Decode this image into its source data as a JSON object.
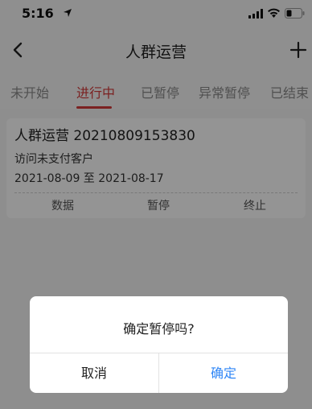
{
  "status_bar": {
    "time": "5:16"
  },
  "nav": {
    "title": "人群运营"
  },
  "tabs": [
    {
      "label": "未开始"
    },
    {
      "label": "进行中",
      "active": true
    },
    {
      "label": "已暂停"
    },
    {
      "label": "异常暂停"
    },
    {
      "label": "已结束"
    }
  ],
  "card": {
    "title": "人群运营 20210809153830",
    "subtitle": "访问未支付客户",
    "date_range": "2021-08-09 至 2021-08-17",
    "actions": [
      "数据",
      "暂停",
      "终止"
    ]
  },
  "dialog": {
    "message": "确定暂停吗?",
    "cancel_label": "取消",
    "confirm_label": "确定"
  },
  "colors": {
    "accent": "#d43a3a",
    "dialog_confirm": "#2f86f6"
  }
}
